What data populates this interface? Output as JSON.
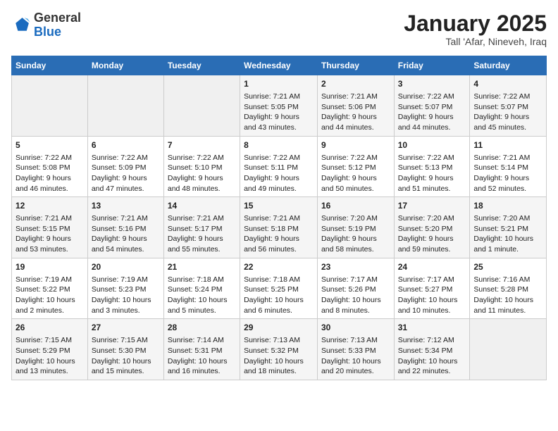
{
  "header": {
    "logo_general": "General",
    "logo_blue": "Blue",
    "title": "January 2025",
    "subtitle": "Tall 'Afar, Nineveh, Iraq"
  },
  "days_of_week": [
    "Sunday",
    "Monday",
    "Tuesday",
    "Wednesday",
    "Thursday",
    "Friday",
    "Saturday"
  ],
  "weeks": [
    [
      {
        "day": "",
        "info": ""
      },
      {
        "day": "",
        "info": ""
      },
      {
        "day": "",
        "info": ""
      },
      {
        "day": "1",
        "info": "Sunrise: 7:21 AM\nSunset: 5:05 PM\nDaylight: 9 hours\nand 43 minutes."
      },
      {
        "day": "2",
        "info": "Sunrise: 7:21 AM\nSunset: 5:06 PM\nDaylight: 9 hours\nand 44 minutes."
      },
      {
        "day": "3",
        "info": "Sunrise: 7:22 AM\nSunset: 5:07 PM\nDaylight: 9 hours\nand 44 minutes."
      },
      {
        "day": "4",
        "info": "Sunrise: 7:22 AM\nSunset: 5:07 PM\nDaylight: 9 hours\nand 45 minutes."
      }
    ],
    [
      {
        "day": "5",
        "info": "Sunrise: 7:22 AM\nSunset: 5:08 PM\nDaylight: 9 hours\nand 46 minutes."
      },
      {
        "day": "6",
        "info": "Sunrise: 7:22 AM\nSunset: 5:09 PM\nDaylight: 9 hours\nand 47 minutes."
      },
      {
        "day": "7",
        "info": "Sunrise: 7:22 AM\nSunset: 5:10 PM\nDaylight: 9 hours\nand 48 minutes."
      },
      {
        "day": "8",
        "info": "Sunrise: 7:22 AM\nSunset: 5:11 PM\nDaylight: 9 hours\nand 49 minutes."
      },
      {
        "day": "9",
        "info": "Sunrise: 7:22 AM\nSunset: 5:12 PM\nDaylight: 9 hours\nand 50 minutes."
      },
      {
        "day": "10",
        "info": "Sunrise: 7:22 AM\nSunset: 5:13 PM\nDaylight: 9 hours\nand 51 minutes."
      },
      {
        "day": "11",
        "info": "Sunrise: 7:21 AM\nSunset: 5:14 PM\nDaylight: 9 hours\nand 52 minutes."
      }
    ],
    [
      {
        "day": "12",
        "info": "Sunrise: 7:21 AM\nSunset: 5:15 PM\nDaylight: 9 hours\nand 53 minutes."
      },
      {
        "day": "13",
        "info": "Sunrise: 7:21 AM\nSunset: 5:16 PM\nDaylight: 9 hours\nand 54 minutes."
      },
      {
        "day": "14",
        "info": "Sunrise: 7:21 AM\nSunset: 5:17 PM\nDaylight: 9 hours\nand 55 minutes."
      },
      {
        "day": "15",
        "info": "Sunrise: 7:21 AM\nSunset: 5:18 PM\nDaylight: 9 hours\nand 56 minutes."
      },
      {
        "day": "16",
        "info": "Sunrise: 7:20 AM\nSunset: 5:19 PM\nDaylight: 9 hours\nand 58 minutes."
      },
      {
        "day": "17",
        "info": "Sunrise: 7:20 AM\nSunset: 5:20 PM\nDaylight: 9 hours\nand 59 minutes."
      },
      {
        "day": "18",
        "info": "Sunrise: 7:20 AM\nSunset: 5:21 PM\nDaylight: 10 hours\nand 1 minute."
      }
    ],
    [
      {
        "day": "19",
        "info": "Sunrise: 7:19 AM\nSunset: 5:22 PM\nDaylight: 10 hours\nand 2 minutes."
      },
      {
        "day": "20",
        "info": "Sunrise: 7:19 AM\nSunset: 5:23 PM\nDaylight: 10 hours\nand 3 minutes."
      },
      {
        "day": "21",
        "info": "Sunrise: 7:18 AM\nSunset: 5:24 PM\nDaylight: 10 hours\nand 5 minutes."
      },
      {
        "day": "22",
        "info": "Sunrise: 7:18 AM\nSunset: 5:25 PM\nDaylight: 10 hours\nand 6 minutes."
      },
      {
        "day": "23",
        "info": "Sunrise: 7:17 AM\nSunset: 5:26 PM\nDaylight: 10 hours\nand 8 minutes."
      },
      {
        "day": "24",
        "info": "Sunrise: 7:17 AM\nSunset: 5:27 PM\nDaylight: 10 hours\nand 10 minutes."
      },
      {
        "day": "25",
        "info": "Sunrise: 7:16 AM\nSunset: 5:28 PM\nDaylight: 10 hours\nand 11 minutes."
      }
    ],
    [
      {
        "day": "26",
        "info": "Sunrise: 7:15 AM\nSunset: 5:29 PM\nDaylight: 10 hours\nand 13 minutes."
      },
      {
        "day": "27",
        "info": "Sunrise: 7:15 AM\nSunset: 5:30 PM\nDaylight: 10 hours\nand 15 minutes."
      },
      {
        "day": "28",
        "info": "Sunrise: 7:14 AM\nSunset: 5:31 PM\nDaylight: 10 hours\nand 16 minutes."
      },
      {
        "day": "29",
        "info": "Sunrise: 7:13 AM\nSunset: 5:32 PM\nDaylight: 10 hours\nand 18 minutes."
      },
      {
        "day": "30",
        "info": "Sunrise: 7:13 AM\nSunset: 5:33 PM\nDaylight: 10 hours\nand 20 minutes."
      },
      {
        "day": "31",
        "info": "Sunrise: 7:12 AM\nSunset: 5:34 PM\nDaylight: 10 hours\nand 22 minutes."
      },
      {
        "day": "",
        "info": ""
      }
    ]
  ]
}
